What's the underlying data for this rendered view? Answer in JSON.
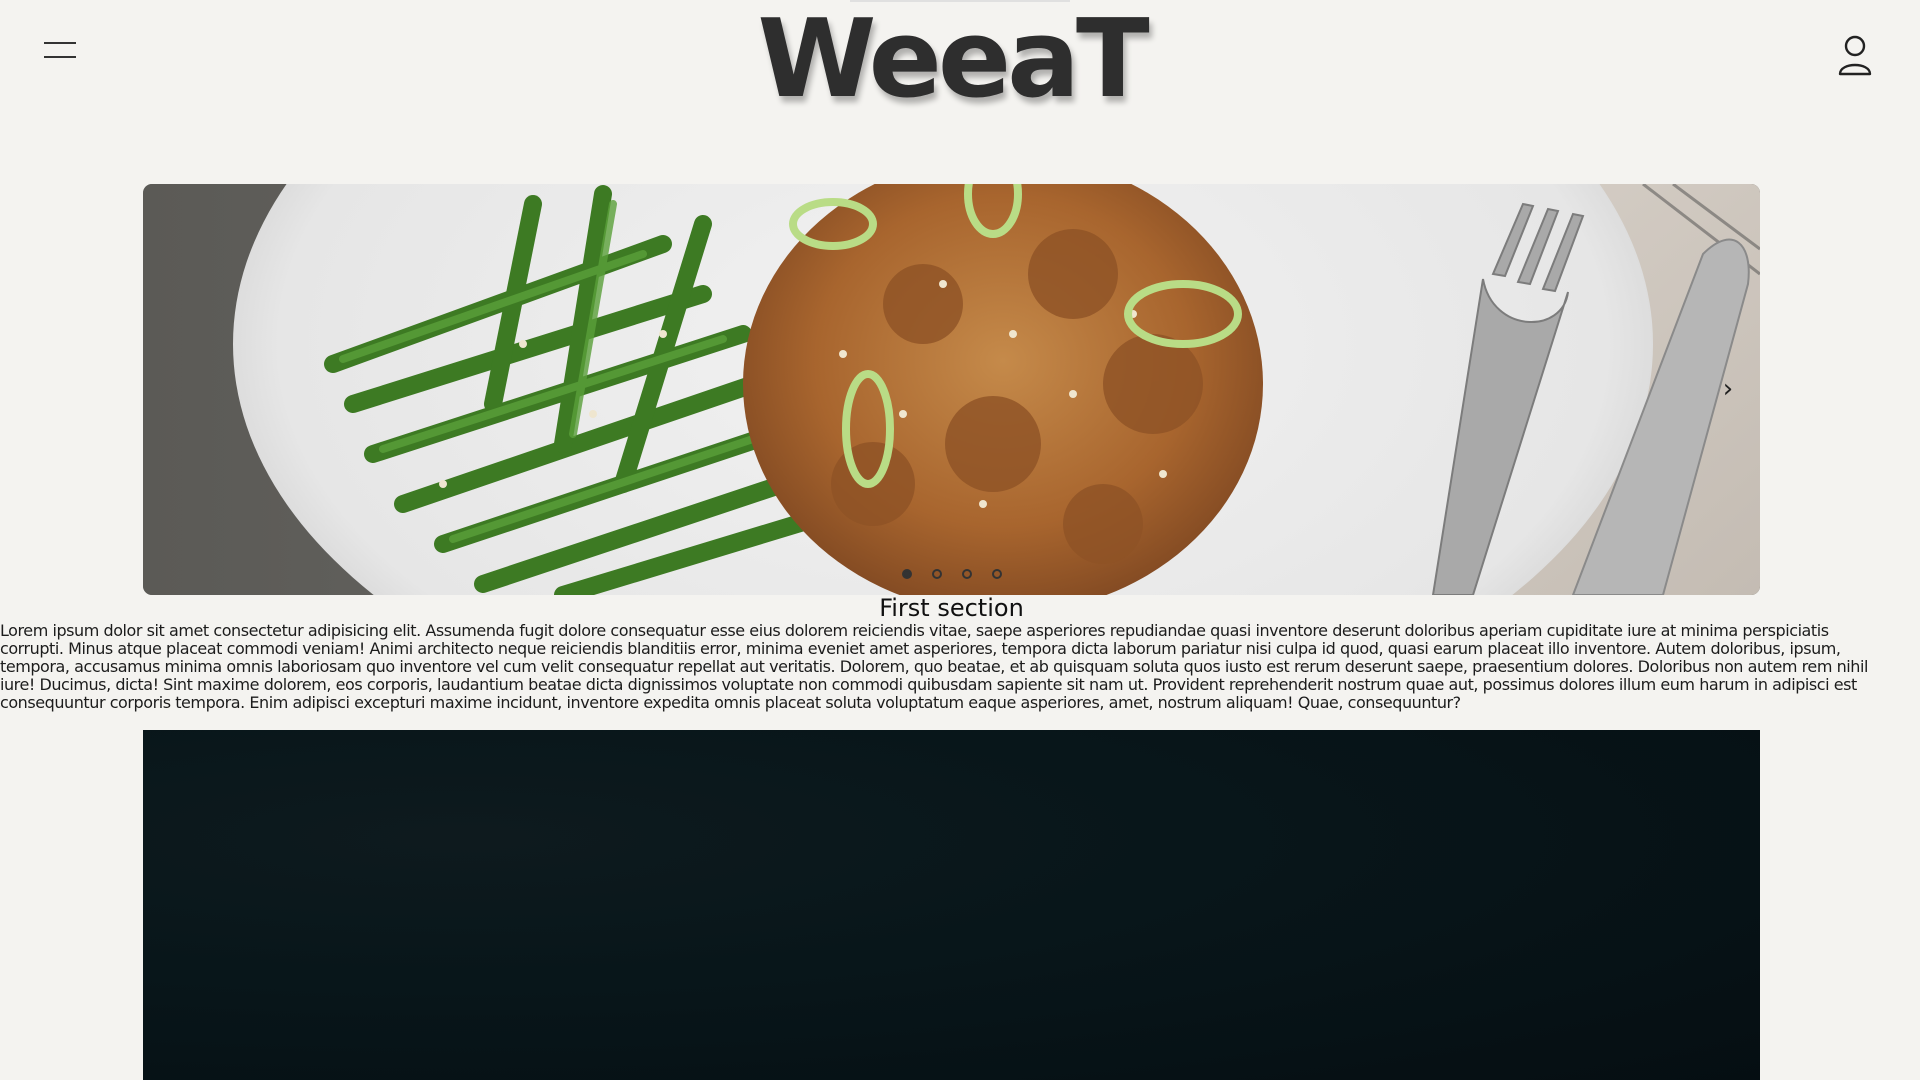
{
  "header": {
    "logo": "WeeaT",
    "menu_icon": "hamburger-menu-icon",
    "user_icon": "user-icon"
  },
  "carousel": {
    "next_label": "›",
    "slide_count": 4,
    "active_index": 0,
    "image_subject": "plate of green beans and glazed chicken with fork and knife"
  },
  "section": {
    "title": "First section",
    "text": "Lorem ipsum dolor sit amet consectetur adipisicing elit. Assumenda fugit dolore consequatur esse eius dolorem reiciendis vitae, saepe asperiores repudiandae quasi inventore deserunt doloribus aperiam cupiditate iure at minima perspiciatis corrupti. Minus atque placeat commodi veniam! Animi architecto neque reiciendis blanditiis error, minima eveniet amet asperiores, tempora dicta laborum pariatur nisi culpa id quod, quasi earum placeat illo inventore. Autem doloribus, ipsum, tempora, accusamus minima omnis laboriosam quo inventore vel cum velit consequatur repellat aut veritatis. Dolorem, quo beatae, et ab quisquam soluta quos iusto est rerum deserunt saepe, praesentium dolores. Doloribus non autem rem nihil iure! Ducimus, dicta! Sint maxime dolorem, eos corporis, laudantium beatae dicta dignissimos voluptate non commodi quibusdam sapiente sit nam ut. Provident reprehenderit nostrum quae aut, possimus dolores illum eum harum in adipisci est consequuntur corporis tempora. Enim adipisci excepturi maxime incidunt, inventore expedita omnis placeat soluta voluptatum eaque asperiores, amet, nostrum aliquam! Quae, consequuntur?"
  },
  "scrollbar": {
    "up_arrow": "▲",
    "down_arrow": "▼"
  },
  "colors": {
    "background": "#f4f3f0",
    "text": "#1c1c1c",
    "logo": "#2e2e2e",
    "dark_block": "#08161a"
  }
}
